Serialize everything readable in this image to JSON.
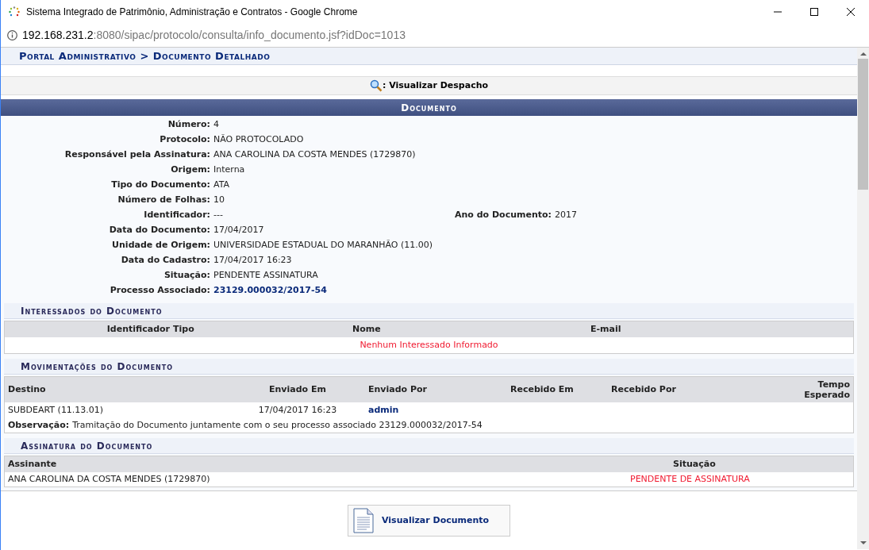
{
  "window": {
    "title": "Sistema Integrado de Patrimônio, Administração e Contratos - Google Chrome"
  },
  "address": {
    "host": "192.168.231.2",
    "path": ":8080/sipac/protocolo/consulta/info_documento.jsf?idDoc=1013"
  },
  "breadcrumb": "Portal Administrativo > Documento Detalhado",
  "action": {
    "label": ": Visualizar Despacho"
  },
  "documento": {
    "title": "Documento",
    "rows": [
      {
        "pairs": [
          {
            "label": "Número:",
            "value": "4",
            "kind": "text"
          }
        ]
      },
      {
        "pairs": [
          {
            "label": "Protocolo:",
            "value": "NÃO PROTOCOLADO",
            "kind": "text"
          }
        ]
      },
      {
        "pairs": [
          {
            "label": "Responsável pela Assinatura:",
            "value": "ANA CAROLINA DA COSTA MENDES (1729870)",
            "kind": "text"
          }
        ]
      },
      {
        "pairs": [
          {
            "label": "Origem:",
            "value": "Interna",
            "kind": "text"
          }
        ]
      },
      {
        "pairs": [
          {
            "label": "Tipo do Documento:",
            "value": "ATA",
            "kind": "text"
          }
        ]
      },
      {
        "pairs": [
          {
            "label": "Número de Folhas:",
            "value": "10",
            "kind": "text"
          }
        ]
      },
      {
        "pairs": [
          {
            "label": "Identificador:",
            "value": "---",
            "kind": "text"
          },
          {
            "label": "Ano do Documento:",
            "value": "2017",
            "kind": "text"
          }
        ]
      },
      {
        "pairs": [
          {
            "label": "Data do Documento:",
            "value": "17/04/2017",
            "kind": "text"
          }
        ]
      },
      {
        "pairs": [
          {
            "label": "Unidade de Origem:",
            "value": "UNIVERSIDADE ESTADUAL DO MARANHÃO (11.00)",
            "kind": "text"
          }
        ]
      },
      {
        "pairs": [
          {
            "label": "Data do Cadastro:",
            "value": "17/04/2017 16:23",
            "kind": "text"
          }
        ]
      },
      {
        "pairs": [
          {
            "label": "Situação:",
            "value": "PENDENTE ASSINATURA",
            "kind": "text"
          }
        ]
      },
      {
        "pairs": [
          {
            "label": "Processo Associado:",
            "value": "23129.000032/2017-54",
            "kind": "link"
          }
        ]
      }
    ]
  },
  "interessados": {
    "title": "Interessados do Documento",
    "columns": [
      "Identificador",
      "Tipo",
      "Nome",
      "E-mail"
    ],
    "empty": "Nenhum Interessado Informado"
  },
  "movimentacoes": {
    "title": "Movimentações do Documento",
    "columns": [
      "Destino",
      "Enviado Em",
      "Enviado Por",
      "Recebido Em",
      "Recebido Por",
      "Tempo Esperado"
    ],
    "rows": [
      {
        "destino": "SUBDEART (11.13.01)",
        "enviado_em": "17/04/2017 16:23",
        "enviado_por": "admin",
        "observacao_label": "Observação:",
        "observacao": "Tramitação do Documento juntamente com o seu processo associado 23129.000032/2017-54"
      }
    ]
  },
  "assinatura": {
    "title": "Assinatura do Documento",
    "columns": [
      "Assinante",
      "Situação"
    ],
    "rows": [
      {
        "assinante": "ANA CAROLINA DA COSTA MENDES (1729870)",
        "situacao": "PENDENTE DE ASSINATURA"
      }
    ]
  },
  "buttons": [
    {
      "label": "Visualizar Documento"
    }
  ]
}
